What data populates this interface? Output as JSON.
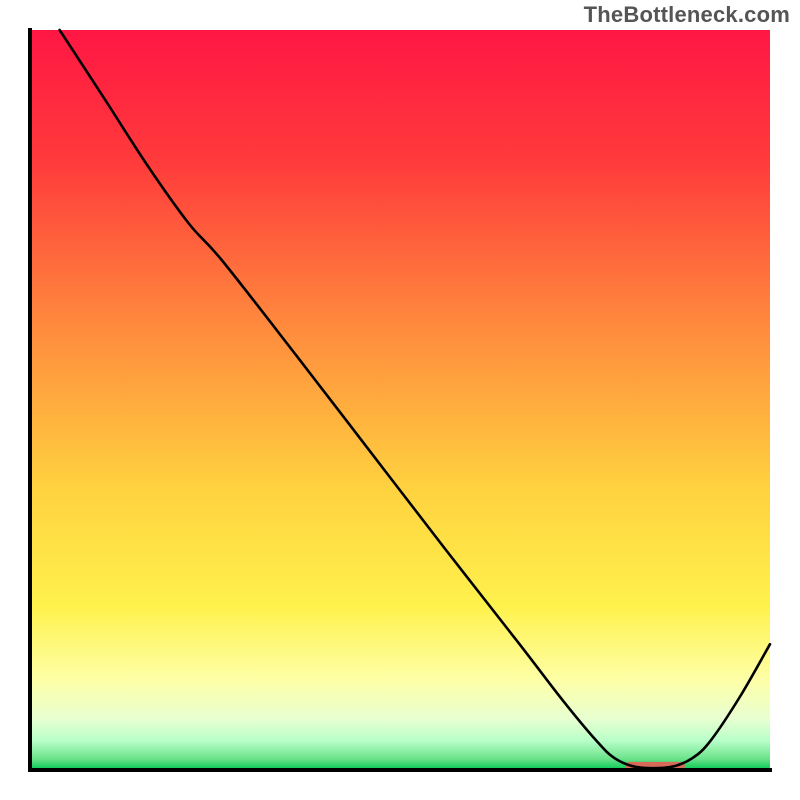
{
  "watermark": "TheBottleneck.com",
  "chart_data": {
    "type": "line",
    "title": "",
    "xlabel": "",
    "ylabel": "",
    "xlim": [
      0,
      100
    ],
    "ylim": [
      0,
      100
    ],
    "background_gradient": {
      "stops": [
        {
          "offset": 0.0,
          "color": "#ff1744"
        },
        {
          "offset": 0.18,
          "color": "#ff3b3b"
        },
        {
          "offset": 0.4,
          "color": "#ff8a3d"
        },
        {
          "offset": 0.62,
          "color": "#ffd23f"
        },
        {
          "offset": 0.78,
          "color": "#fff24d"
        },
        {
          "offset": 0.88,
          "color": "#fdffa8"
        },
        {
          "offset": 0.93,
          "color": "#e8ffd0"
        },
        {
          "offset": 0.96,
          "color": "#b9ffc9"
        },
        {
          "offset": 0.985,
          "color": "#6be28a"
        },
        {
          "offset": 1.0,
          "color": "#00c853"
        }
      ]
    },
    "axis_color": "#000000",
    "axis_width": 4,
    "series": [
      {
        "name": "bottleneck-curve",
        "color": "#000000",
        "width": 2.6,
        "points": [
          {
            "x": 4.0,
            "y": 100.0
          },
          {
            "x": 10.0,
            "y": 90.8
          },
          {
            "x": 16.0,
            "y": 81.5
          },
          {
            "x": 21.5,
            "y": 73.8
          },
          {
            "x": 26.0,
            "y": 68.8
          },
          {
            "x": 36.0,
            "y": 56.0
          },
          {
            "x": 46.0,
            "y": 43.0
          },
          {
            "x": 56.0,
            "y": 30.0
          },
          {
            "x": 66.0,
            "y": 17.2
          },
          {
            "x": 72.0,
            "y": 9.4
          },
          {
            "x": 76.5,
            "y": 4.0
          },
          {
            "x": 79.0,
            "y": 1.6
          },
          {
            "x": 82.0,
            "y": 0.4
          },
          {
            "x": 86.5,
            "y": 0.4
          },
          {
            "x": 89.5,
            "y": 1.6
          },
          {
            "x": 92.0,
            "y": 4.0
          },
          {
            "x": 96.0,
            "y": 10.0
          },
          {
            "x": 100.0,
            "y": 17.0
          }
        ]
      }
    ],
    "trough_marker": {
      "name": "optimal-range",
      "color": "#d86a5a",
      "x_start": 80.5,
      "x_end": 88.5,
      "y": 0.55,
      "thickness": 1.1
    }
  }
}
